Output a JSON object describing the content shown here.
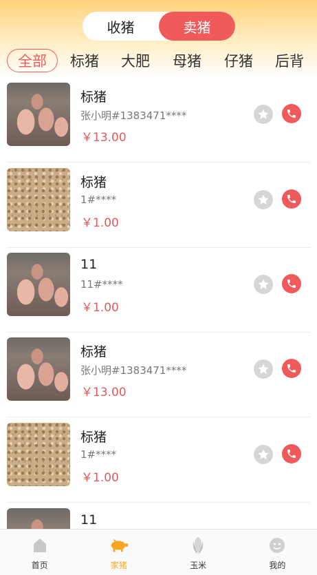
{
  "header": {
    "toggle": {
      "buy_label": "收猪",
      "sell_label": "卖猪",
      "active": "sell"
    },
    "categories": [
      {
        "label": "全部",
        "active": true
      },
      {
        "label": "标猪",
        "active": false
      },
      {
        "label": "大肥",
        "active": false
      },
      {
        "label": "母猪",
        "active": false
      },
      {
        "label": "仔猪",
        "active": false
      },
      {
        "label": "后背",
        "active": false
      }
    ]
  },
  "listings": [
    {
      "title": "标猪",
      "seller": "张小明#1383471****",
      "price": "￥13.00",
      "thumb": "pig"
    },
    {
      "title": "标猪",
      "seller": "1#****",
      "price": "￥1.00",
      "thumb": "corn"
    },
    {
      "title": "11",
      "seller": "11#****",
      "price": "￥1.00",
      "thumb": "pig"
    },
    {
      "title": "标猪",
      "seller": "张小明#1383471****",
      "price": "￥13.00",
      "thumb": "pig"
    },
    {
      "title": "标猪",
      "seller": "1#****",
      "price": "￥1.00",
      "thumb": "corn"
    },
    {
      "title": "11",
      "seller": "",
      "price": "",
      "thumb": "pig"
    }
  ],
  "tabbar": {
    "items": [
      {
        "label": "首页",
        "icon": "home-icon",
        "active": false
      },
      {
        "label": "家猪",
        "icon": "pig-icon",
        "active": true
      },
      {
        "label": "玉米",
        "icon": "corn-icon",
        "active": false
      },
      {
        "label": "我的",
        "icon": "profile-icon",
        "active": false
      }
    ]
  },
  "colors": {
    "accent": "#f05a5a",
    "header_gold": "#ffd27a",
    "price_red": "#e45a5a",
    "tab_active": "#f5a623"
  }
}
